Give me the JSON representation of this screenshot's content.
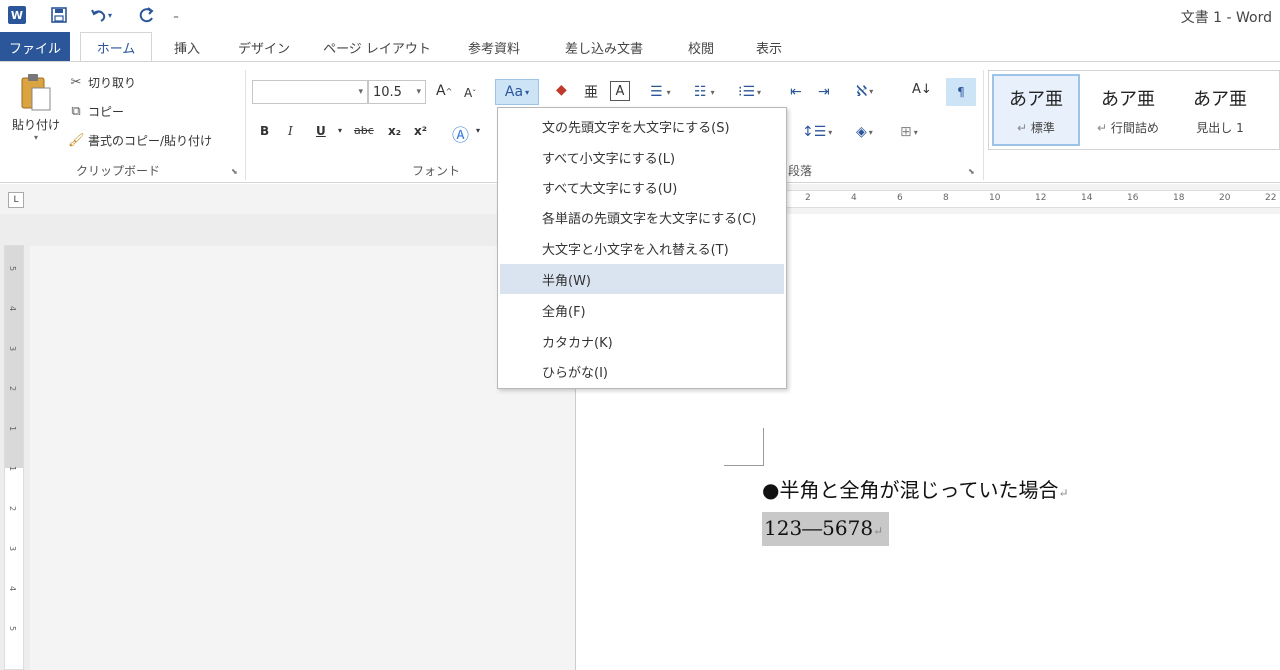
{
  "window": {
    "title": "文書 1 - Word",
    "app_icon": "W"
  },
  "qat": {
    "save": "save-icon",
    "undo": "undo-icon",
    "redo": "redo-icon",
    "more": "customize-icon"
  },
  "tabs": [
    "ファイル",
    "ホーム",
    "挿入",
    "デザイン",
    "ページ レイアウト",
    "参考資料",
    "差し込み文書",
    "校閲",
    "表示"
  ],
  "clipboard": {
    "paste": "貼り付け",
    "cut": "切り取り",
    "copy": "コピー",
    "format_painter": "書式のコピー/貼り付け",
    "group": "クリップボード"
  },
  "font": {
    "name": "",
    "size": "10.5",
    "group": "フォント",
    "case_button": "Aa",
    "grow": "A",
    "shrink": "A",
    "bold": "B",
    "italic": "I",
    "underline": "U",
    "strike": "abc",
    "sub": "x₂",
    "sup": "x²"
  },
  "paragraph": {
    "group": "段落"
  },
  "styles": [
    {
      "preview": "あア亜",
      "name": "標準"
    },
    {
      "preview": "あア亜",
      "name": "行間詰め"
    },
    {
      "preview": "あア亜",
      "name": "見出し 1"
    }
  ],
  "ruler": {
    "ticks": [
      "2",
      "4",
      "6",
      "8",
      "10",
      "12",
      "14",
      "16",
      "18",
      "20",
      "22"
    ],
    "vticks": [
      "5",
      "4",
      "3",
      "2",
      "1",
      "1",
      "2",
      "3",
      "4",
      "5"
    ],
    "tab_selector": "L"
  },
  "case_menu": {
    "items": [
      {
        "label": "文の先頭文字を大文字にする(S)"
      },
      {
        "label": "すべて小文字にする(L)"
      },
      {
        "label": "すべて大文字にする(U)"
      },
      {
        "label": "各単語の先頭文字を大文字にする(C)"
      },
      {
        "label": "大文字と小文字を入れ替える(T)"
      },
      {
        "label": "半角(W)"
      },
      {
        "label": "全角(F)"
      },
      {
        "label": "カタカナ(K)"
      },
      {
        "label": "ひらがな(I)"
      }
    ],
    "selected": "半角(W)"
  },
  "document": {
    "line1": "●半角と全角が混じっていた場合",
    "line2": "123―5678",
    "para_mark": "↵"
  }
}
